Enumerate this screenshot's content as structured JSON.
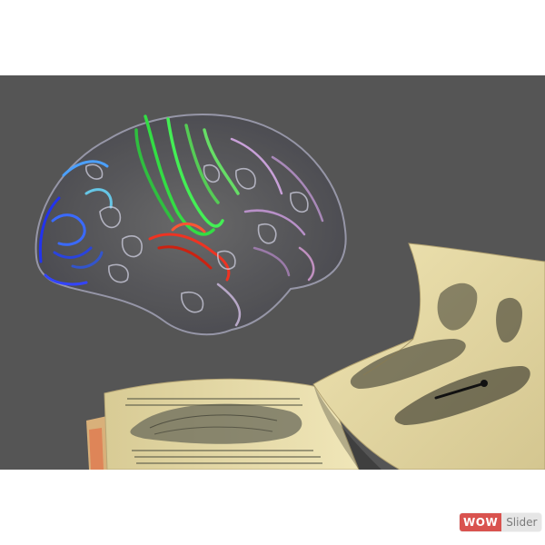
{
  "scene": {
    "background_color": "#555555",
    "page_background": "#ffffff",
    "subjects": [
      "brain-mesh",
      "open-anatomy-book"
    ],
    "brain_colors": {
      "frontal": "#3344ff",
      "motor": "#33dd44",
      "temporal": "#ee3322",
      "parietal": "#c8a0d8",
      "wire": "#cfcfe0"
    },
    "book_paper_color": "#e8dca8"
  },
  "watermark": {
    "part1": "WOW",
    "part2": "Slider",
    "color1": "#d9534f",
    "color2": "#7a7a7a"
  }
}
